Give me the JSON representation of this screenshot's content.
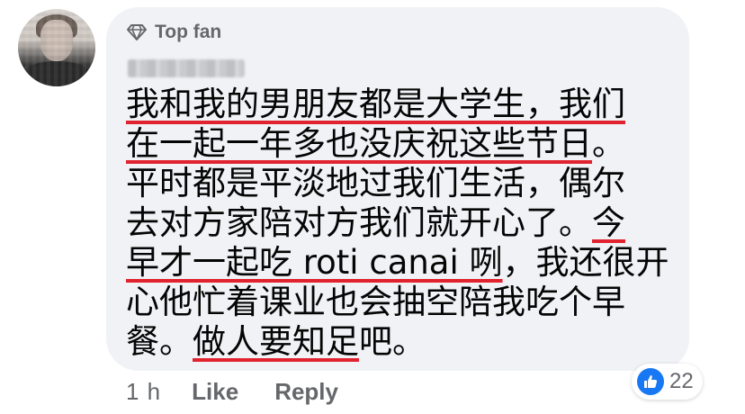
{
  "comment": {
    "badge_label": "Top fan",
    "badge_icon": "diamond-icon",
    "lines": [
      "我和我的男朋友都是大学生，我们",
      "在一起一年多也没庆祝这些节日。",
      "平时都是平淡地过我们生活，偶尔",
      "去对方家陪对方我们就开心了。今",
      "早才一起吃 roti canai 咧，我还很开",
      "心他忙着课业也会抽空陪我吃个早",
      "餐。做人要知足吧。"
    ],
    "underline_color": "#e0232f"
  },
  "reactions": {
    "icon": "like-icon",
    "count": "22",
    "color": "#1877f2"
  },
  "actions": {
    "time": "1 h",
    "like_label": "Like",
    "reply_label": "Reply"
  }
}
